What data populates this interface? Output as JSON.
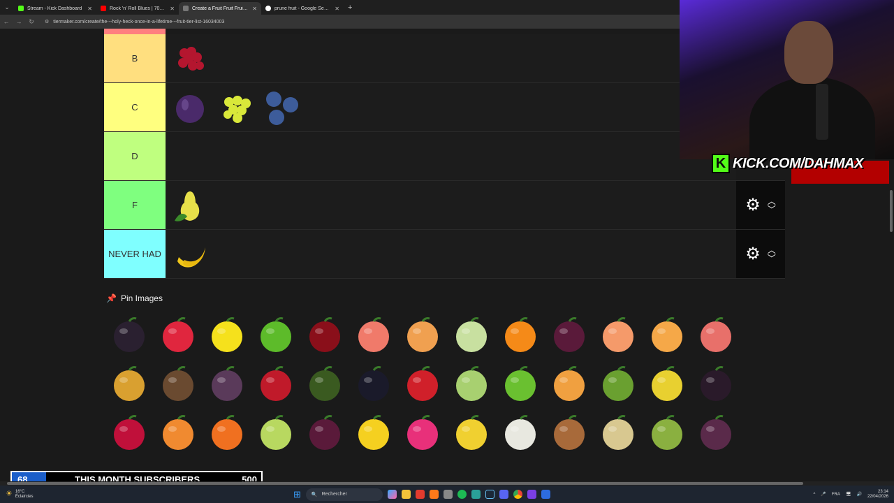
{
  "browser": {
    "tabs": [
      {
        "title": "Stream - Kick Dashboard",
        "favicon_color": "#53fc18",
        "active": false
      },
      {
        "title": "Rock 'n' Roll Blues | 70s Su...",
        "favicon_color": "#ff0000",
        "active": false
      },
      {
        "title": "Create a Fruit Fruit Fruit F...",
        "favicon_color": "#444444",
        "active": true
      },
      {
        "title": "prune fruit - Google Search",
        "favicon_color": "#ffffff",
        "active": false
      }
    ],
    "url": "tiermaker.com/create/the---holy-heck-once-in-a-lifetime---fruit-tier-list-16034003"
  },
  "tiers": [
    {
      "label": "B",
      "color": "#ffdf7f",
      "items": [
        "raspberry-cluster"
      ]
    },
    {
      "label": "C",
      "color": "#ffff7f",
      "items": [
        "plum",
        "green-grapes",
        "blueberries"
      ]
    },
    {
      "label": "D",
      "color": "#bfff7f",
      "items": []
    },
    {
      "label": "F",
      "color": "#7fff7f",
      "items": [
        "pear"
      ],
      "has_controls": true
    },
    {
      "label": "NEVER HAD",
      "color": "#7fffff",
      "items": [
        "banana"
      ],
      "has_controls": true
    }
  ],
  "pin_images": {
    "title": "Pin Images",
    "items": [
      "blackberry",
      "raspberry",
      "lemon",
      "lime",
      "cherries",
      "grapefruit",
      "cantaloupe",
      "honeydew",
      "mandarin",
      "plums",
      "peach",
      "apricots",
      "nectarine",
      "pineapple",
      "coconut",
      "fig",
      "pomegranate",
      "avocado",
      "blackcurrant",
      "redcurrant",
      "gooseberry",
      "green-apple",
      "melon-slice",
      "kiwi",
      "golden-kiwi",
      "mulberry",
      "cranberry",
      "papaya",
      "persimmon",
      "guava",
      "passion-fruit",
      "star-fruit",
      "dragon-fruit",
      "yellow-dragon-fruit",
      "white-dragon-fruit",
      "sapodilla",
      "longan",
      "feijoa",
      "mangosteen"
    ]
  },
  "overlay": {
    "kick_url": "KICK.COM/DAHMAX",
    "subs_current": "68",
    "subs_label": "THIS MONTH SUBSCRIBERS",
    "subs_goal": "500",
    "subs_progress": 0.136
  },
  "taskbar": {
    "temp": "16°C",
    "weather": "Éclaircies",
    "search_placeholder": "Rechercher",
    "lang": "FRA",
    "time": "23:14",
    "date": "22/04/2026"
  },
  "colors": {
    "accent_kick": "#53fc18",
    "subs_bar": "#1b5ec9",
    "pin_icon": "#e2557a"
  }
}
